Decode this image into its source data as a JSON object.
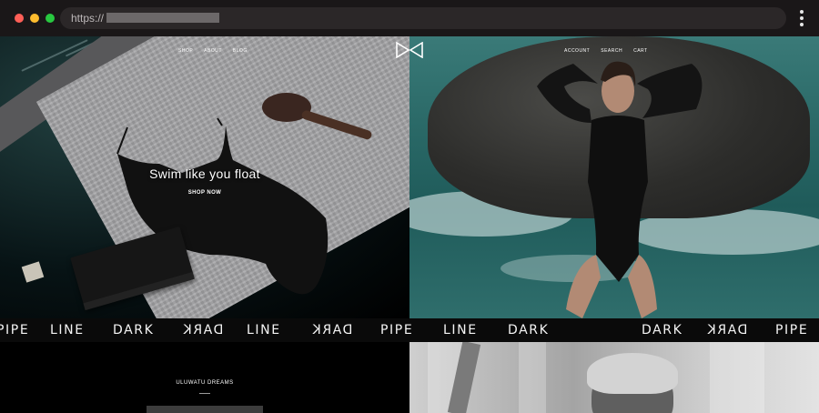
{
  "browser": {
    "url_prefix": "https://",
    "dot_colors": [
      "#ff5f57",
      "#febc2e",
      "#28c840"
    ]
  },
  "nav": {
    "left": [
      "SHOP",
      "ABOUT",
      "BLOG"
    ],
    "right": [
      "ACCOUNT",
      "SEARCH",
      "CART"
    ]
  },
  "hero": {
    "title": "Swim like you float",
    "cta": "SHOP NOW"
  },
  "marquee": {
    "words": [
      "PIPE",
      "LINE",
      "DARK",
      "DARK",
      "PIPE",
      "LINE",
      "DARK",
      "DARK",
      "PIPE",
      "LINE",
      "DARK",
      "DARK"
    ]
  },
  "section": {
    "title": "ULUWATU DREAMS"
  },
  "colors": {
    "accent": "#ffffff",
    "chrome": "#1a1718",
    "marquee_bg": "#0a0a0a"
  }
}
